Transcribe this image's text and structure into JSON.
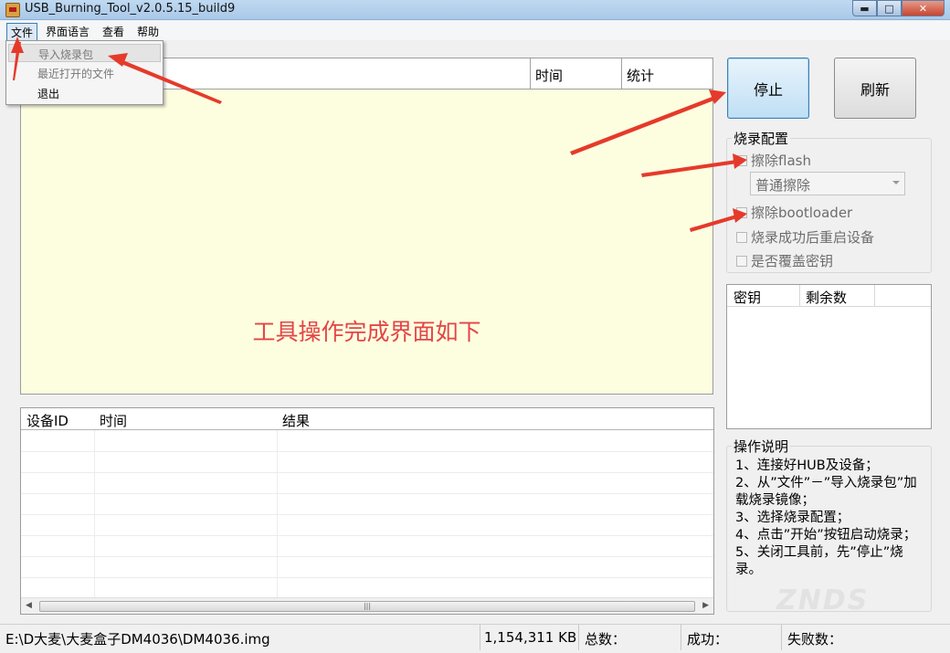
{
  "window": {
    "title": "USB_Burning_Tool_v2.0.5.15_build9",
    "min_label": "▬",
    "max_label": "□",
    "close_label": "✕"
  },
  "menubar": {
    "items": [
      "文件",
      "界面语言",
      "查看",
      "帮助"
    ]
  },
  "file_menu": {
    "items": [
      "导入烧录包",
      "最近打开的文件",
      "退出"
    ]
  },
  "upper_table": {
    "columns": [
      "时间",
      "统计"
    ]
  },
  "center_message": "工具操作完成界面如下",
  "lower_table": {
    "columns": [
      "设备ID",
      "时间",
      "结果"
    ],
    "scroll_left": "◀",
    "scroll_right": "▶",
    "thumb_grip": "|||"
  },
  "buttons": {
    "stop": "停止",
    "refresh": "刷新"
  },
  "burn_config": {
    "title": "烧录配置",
    "erase_flash": "擦除flash",
    "erase_mode": "普通擦除",
    "erase_bootloader": "擦除bootloader",
    "reboot_after": "烧录成功后重启设备",
    "overwrite_key": "是否覆盖密钥"
  },
  "key_table": {
    "columns": [
      "密钥",
      "剩余数"
    ]
  },
  "instructions": {
    "title": "操作说明",
    "lines": [
      "1、连接好HUB及设备；",
      "2、从”文件”－”导入烧录包”加载烧录镜像；",
      "3、选择烧录配置；",
      "4、点击”开始”按钮启动烧录；",
      "5、关闭工具前，先”停止”烧录。"
    ]
  },
  "statusbar": {
    "path": "E:\\D大麦\\大麦盒子DM4036\\DM4036.img",
    "size": "1,154,311 KB",
    "total": "总数：",
    "success": "成功：",
    "fail": "失败数："
  },
  "watermark": "ZNDS",
  "colors": {
    "accent_red": "#e34545",
    "list_bg": "#fdfde0",
    "stop_button": "#bfdff4"
  }
}
